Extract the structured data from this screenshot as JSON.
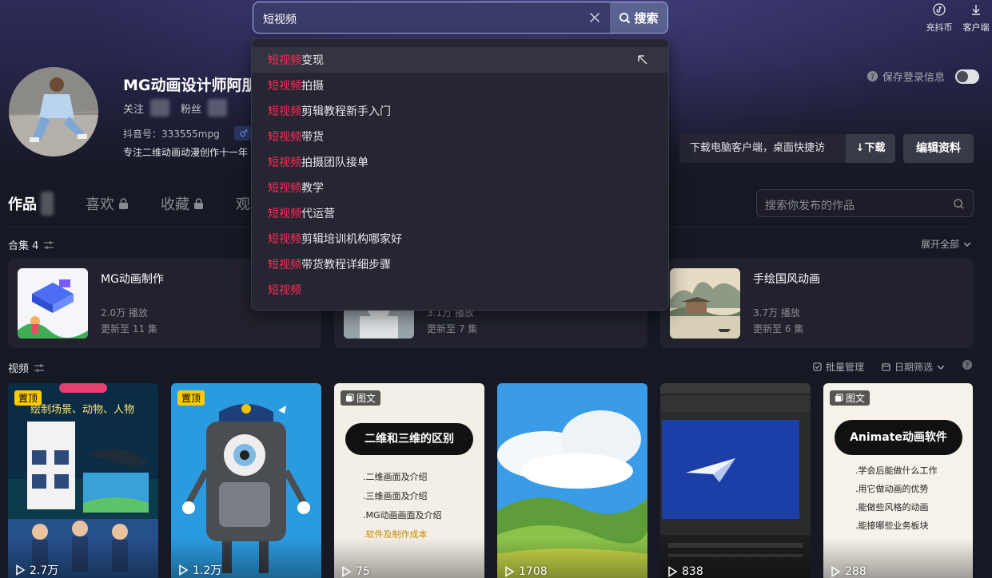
{
  "search": {
    "query": "短视频",
    "button_label": "搜索",
    "suggestions": [
      {
        "kw": "短视频",
        "rest": "变现"
      },
      {
        "kw": "短视频",
        "rest": "拍摄"
      },
      {
        "kw": "短视频",
        "rest": "剪辑教程新手入门"
      },
      {
        "kw": "短视频",
        "rest": "带货"
      },
      {
        "kw": "短视频",
        "rest": "拍摄团队接单"
      },
      {
        "kw": "短视频",
        "rest": "教学"
      },
      {
        "kw": "短视频",
        "rest": "代运营"
      },
      {
        "kw": "短视频",
        "rest": "剪辑培训机构哪家好"
      },
      {
        "kw": "短视频",
        "rest": "带货教程详细步骤"
      },
      {
        "kw": "短视频",
        "rest": ""
      }
    ]
  },
  "top_right": {
    "coin_label": "充抖币",
    "client_label": "客户端"
  },
  "profile": {
    "name": "MG动画设计师阿朋",
    "following_label": "关注",
    "followers_label": "粉丝",
    "douyin_id": "抖音号：333555mpg",
    "gender_icon": "♂",
    "bio": "专注二维动画动漫创作十一年"
  },
  "save_login_label": "保存登录信息",
  "download": {
    "text": "下载电脑客户端，桌面快捷访问",
    "button": "↓下载"
  },
  "edit_profile_label": "编辑资料",
  "tabs": [
    {
      "label": "作品",
      "active": true,
      "locked": false
    },
    {
      "label": "喜欢",
      "active": false,
      "locked": true
    },
    {
      "label": "收藏",
      "active": false,
      "locked": true
    },
    {
      "label": "观",
      "active": false,
      "locked": false
    }
  ],
  "work_search_placeholder": "搜索你发布的作品",
  "collections_section": {
    "title": "合集 4",
    "expand_label": "展开全部"
  },
  "collections": [
    {
      "title": "MG动画制作",
      "plays": "2.0万 播放",
      "updates": "更新至 11 集"
    },
    {
      "title": "",
      "plays": "3.1万 播放",
      "updates": "更新至 7 集"
    },
    {
      "title": "手绘国风动画",
      "plays": "3.7万 播放",
      "updates": "更新至 6 集"
    }
  ],
  "videos_section": {
    "title": "视频",
    "batch_label": "批量管理",
    "date_filter_label": "日期筛选",
    "help": "?"
  },
  "videos": [
    {
      "badge": "置顶",
      "type": "video",
      "plays": "2.7万",
      "caption": "绘制场景、动物、人物"
    },
    {
      "badge": "置顶",
      "type": "video",
      "plays": "1.2万",
      "caption": ""
    },
    {
      "badge": "图文",
      "type": "image",
      "plays": "75",
      "caption": "二维和三维的区别",
      "lines": [
        ".二维画面及介绍",
        ".三维画面及介绍",
        ".MG动画画面及介绍",
        ".软件及制作成本"
      ]
    },
    {
      "badge": "",
      "type": "video",
      "plays": "1708",
      "caption": ""
    },
    {
      "badge": "",
      "type": "video",
      "plays": "838",
      "caption": ""
    },
    {
      "badge": "图文",
      "type": "image",
      "plays": "288",
      "caption": "Animate动画软件",
      "lines": [
        ".学会后能做什么工作",
        ".用它做动画的优势",
        ".能做些风格的动画",
        ".能接哪些业务板块"
      ]
    }
  ],
  "colors": {
    "accent_red": "#fe2c55",
    "badge_yellow": "#fbcc00",
    "background": "#161823"
  }
}
